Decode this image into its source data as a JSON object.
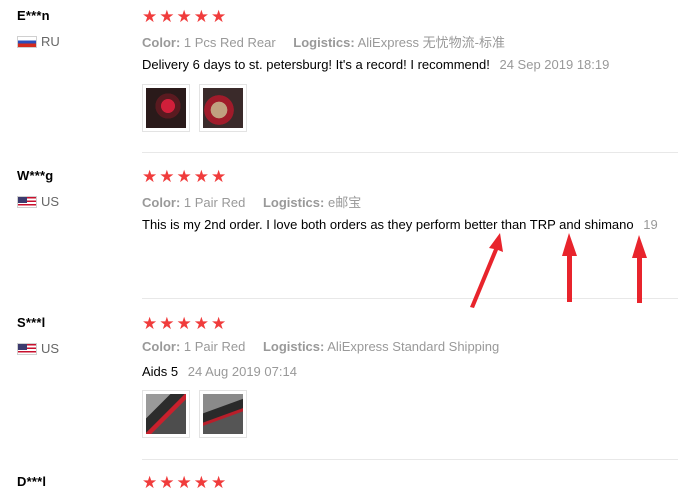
{
  "reviews": [
    {
      "user": "E***n",
      "country": "RU",
      "stars": "★★★★★",
      "color_label": "Color:",
      "color_value": "1 Pcs Red Rear",
      "logistics_label": "Logistics:",
      "logistics_value": "AliExpress 无忧物流-标准",
      "text": "Delivery 6 days to st. petersburg! It's a record! I recommend!",
      "date": "24 Sep 2019 18:19"
    },
    {
      "user": "W***g",
      "country": "US",
      "stars": "★★★★★",
      "color_label": "Color:",
      "color_value": "1 Pair Red",
      "logistics_label": "Logistics:",
      "logistics_value": "e邮宝",
      "text": "This is my 2nd order. I love both orders as they perform better than TRP and shimano",
      "date": "19"
    },
    {
      "user": "S***l",
      "country": "US",
      "stars": "★★★★★",
      "color_label": "Color:",
      "color_value": "1 Pair Red",
      "logistics_label": "Logistics:",
      "logistics_value": "AliExpress Standard Shipping",
      "text": "Aids 5",
      "date": "24 Aug 2019 07:14"
    },
    {
      "user": "D***l",
      "stars": "★★★★★"
    }
  ],
  "colors": {
    "star": "#f03c3c",
    "arrow": "#e8242c",
    "meta_gray": "#999999"
  }
}
